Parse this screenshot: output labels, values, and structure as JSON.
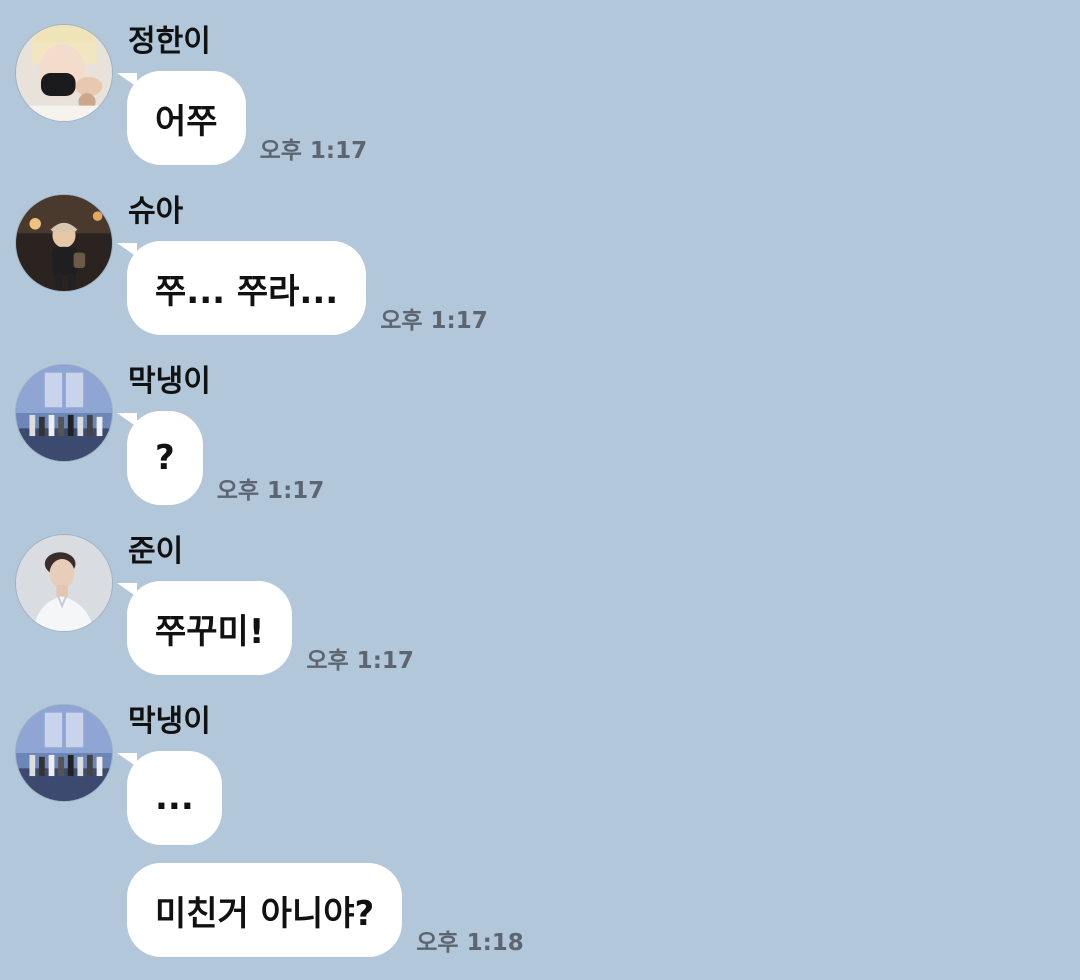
{
  "messages": [
    {
      "sender": "정한이",
      "avatar_icon": "avatar-masked-person",
      "bubbles": [
        "어쭈"
      ],
      "time": "오후 1:17"
    },
    {
      "sender": "슈아",
      "avatar_icon": "avatar-child-cap",
      "bubbles": [
        "쭈... 쭈라..."
      ],
      "time": "오후 1:17"
    },
    {
      "sender": "막냉이",
      "avatar_icon": "avatar-group-stage",
      "bubbles": [
        "?"
      ],
      "time": "오후 1:17"
    },
    {
      "sender": "준이",
      "avatar_icon": "avatar-profile-person",
      "bubbles": [
        "쭈꾸미!"
      ],
      "time": "오후 1:17"
    },
    {
      "sender": "막냉이",
      "avatar_icon": "avatar-group-stage",
      "bubbles": [
        "...",
        "미친거 아니야?"
      ],
      "time": "오후 1:18"
    }
  ],
  "colors": {
    "background": "#b2c7da",
    "bubble": "#ffffff",
    "time_text": "#5d6670"
  }
}
